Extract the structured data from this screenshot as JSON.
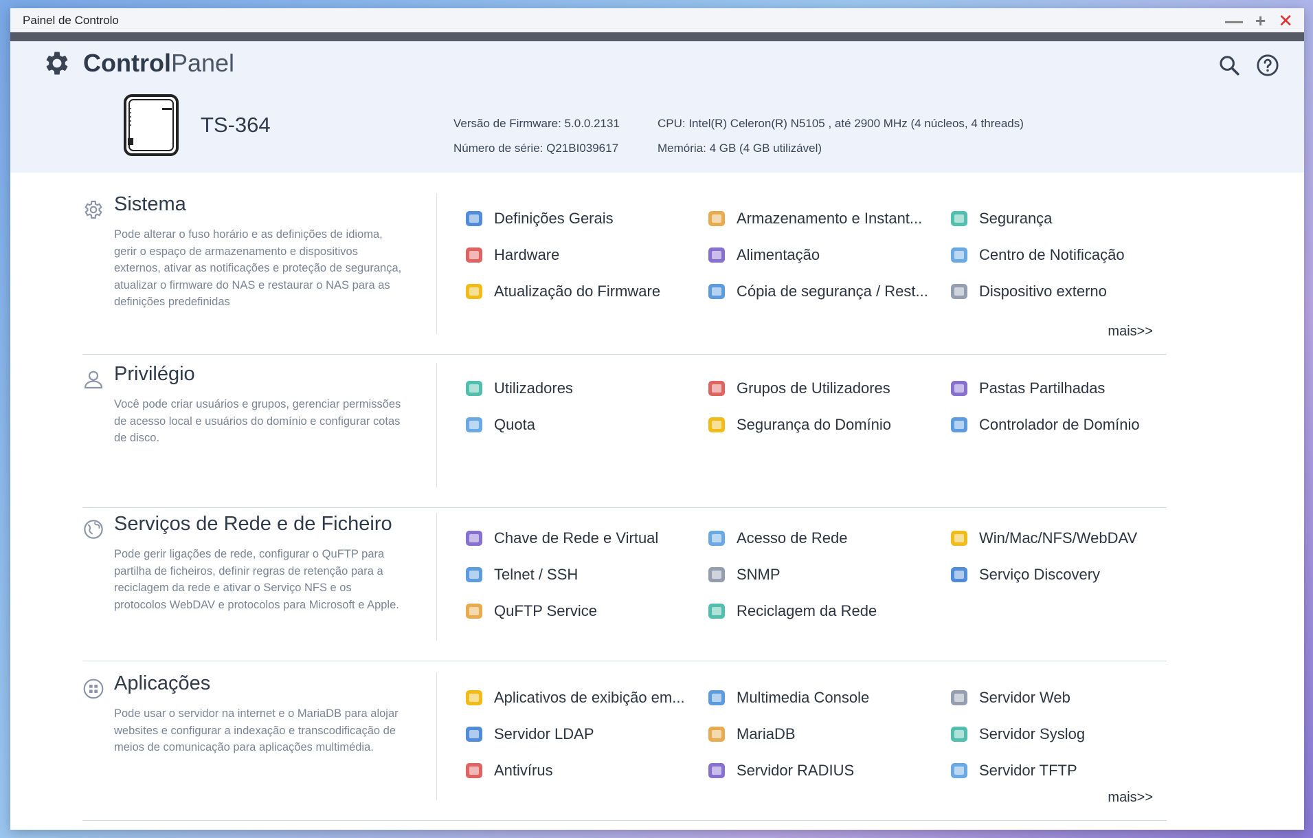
{
  "window": {
    "title": "Painel de Controlo"
  },
  "header": {
    "brand_bold": "Control",
    "brand_light": "Panel",
    "model": "TS-364",
    "firmware": "Versão de Firmware:  5.0.0.2131",
    "serial": "Número de série:  Q21BI039617",
    "cpu": "CPU:  Intel(R) Celeron(R) N5105 , até 2900 MHz (4 núcleos, 4 threads)",
    "memory": "Memória:  4 GB (4 GB utilizável)"
  },
  "sections": [
    {
      "title": "Sistema",
      "desc": "Pode alterar o fuso horário e as definições de idioma, gerir o espaço de armazenamento e dispositivos externos, ativar as notificações e proteção de segurança, atualizar o firmware do NAS e restaurar o NAS para as definições predefinidas",
      "items": [
        "Definições Gerais",
        "Armazenamento e Instant...",
        "Segurança",
        "Hardware",
        "Alimentação",
        "Centro de Notificação",
        "Atualização do Firmware",
        "Cópia de segurança / Rest...",
        "Dispositivo externo"
      ],
      "more": "mais>>"
    },
    {
      "title": "Privilégio",
      "desc": "Você pode criar usuários e grupos, gerenciar permissões de acesso local e usuários do domínio e configurar cotas de disco.",
      "items": [
        "Utilizadores",
        "Grupos de Utilizadores",
        "Pastas Partilhadas",
        "Quota",
        "Segurança do Domínio",
        "Controlador de Domínio"
      ]
    },
    {
      "title": "Serviços de Rede e de Ficheiro",
      "desc": "Pode gerir ligações de rede, configurar o QuFTP para partilha de ficheiros, definir regras de retenção para a reciclagem da rede e ativar o Serviço NFS e os protocolos WebDAV e protocolos para Microsoft e Apple.",
      "items": [
        "Chave de Rede e Virtual",
        "Acesso de Rede",
        "Win/Mac/NFS/WebDAV",
        "Telnet / SSH",
        "SNMP",
        "Serviço Discovery",
        "QuFTP Service",
        "Reciclagem da Rede"
      ]
    },
    {
      "title": "Aplicações",
      "desc": "Pode usar o servidor na internet e o MariaDB para alojar websites e configurar a indexação e transcodificação de meios de comunicação para aplicações multimédia.",
      "items": [
        "Aplicativos de exibição em...",
        "Multimedia Console",
        "Servidor Web",
        "Servidor LDAP",
        "MariaDB",
        "Servidor Syslog",
        "Antivírus",
        "Servidor RADIUS",
        "Servidor TFTP"
      ],
      "more": "mais>>"
    }
  ],
  "icons": {
    "section_icons": [
      "gear-icon",
      "user-icon",
      "globe-icon",
      "apps-icon"
    ],
    "item_colors": [
      "#3d7fd6",
      "#e6a23c",
      "#3fb8a5",
      "#d9534f",
      "#7b61c9",
      "#5aa0e0",
      "#f0b400",
      "#4a90d9",
      "#8a94a6"
    ]
  }
}
